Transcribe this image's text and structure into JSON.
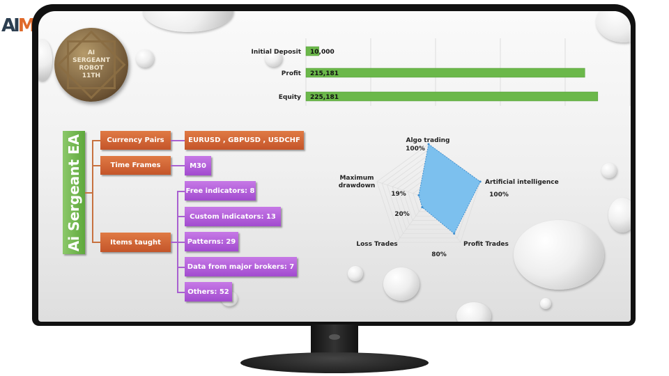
{
  "logo": {
    "text_a": "AI",
    "text_m": "M"
  },
  "medal": {
    "lines": [
      "AI",
      "SERGEANT",
      "ROBOT",
      "11TH"
    ]
  },
  "mindmap": {
    "title": "Ai Sergeant EA",
    "branches": [
      {
        "label": "Currency Pairs",
        "children": [
          "EURUSD , GBPUSD , USDCHF"
        ]
      },
      {
        "label": "Time Frames",
        "children": [
          "M30"
        ]
      },
      {
        "label": "Items taught",
        "children": [
          "Free indicators: 8",
          "Custom indicators: 13",
          "Patterns: 29",
          "Data from major brokers: 7",
          "Others: 52"
        ]
      }
    ]
  },
  "chart_data": [
    {
      "type": "bar",
      "orientation": "horizontal",
      "categories": [
        "Initial Deposit",
        "Profit",
        "Equity"
      ],
      "values": [
        10000,
        215181,
        225181
      ],
      "data_labels": [
        "10,000",
        "215,181",
        "225,181"
      ],
      "xlim": [
        0,
        250000
      ],
      "grid": true,
      "color": "#6bb84a"
    },
    {
      "type": "radar",
      "categories": [
        "Algo trading",
        "Artificial intelligence",
        "Profit Trades",
        "Loss Trades",
        "Maximum drawdown"
      ],
      "values": [
        100,
        100,
        80,
        20,
        19
      ],
      "data_labels": [
        "100%",
        "100%",
        "80%",
        "20%",
        "19%"
      ],
      "range": [
        0,
        100
      ],
      "color": "#7cc0ee"
    }
  ]
}
